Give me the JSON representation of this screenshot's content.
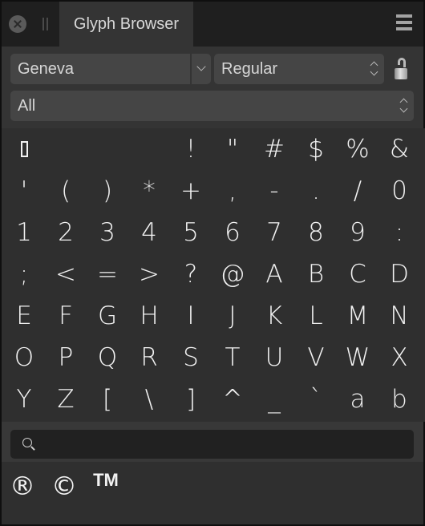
{
  "window": {
    "tab_title": "Glyph Browser",
    "close_icon": "close-circle-icon",
    "grip_icon": "drag-grip-icon",
    "menu_icon": "hamburger-menu-icon"
  },
  "controls": {
    "font_family": "Geneva",
    "font_style": "Regular",
    "lock_icon": "unlocked-padlock-icon",
    "category": "All"
  },
  "glyphs": [
    "▯",
    " ",
    " ",
    " ",
    "!",
    "\"",
    "#",
    "$",
    "%",
    "&",
    "'",
    "(",
    ")",
    "*",
    "+",
    ",",
    "-",
    ".",
    "/",
    "0",
    "1",
    "2",
    "3",
    "4",
    "5",
    "6",
    "7",
    "8",
    "9",
    ":",
    ";",
    "<",
    "=",
    ">",
    "?",
    "@",
    "A",
    "B",
    "C",
    "D",
    "E",
    "F",
    "G",
    "H",
    "I",
    "J",
    "K",
    "L",
    "M",
    "N",
    "O",
    "P",
    "Q",
    "R",
    "S",
    "T",
    "U",
    "V",
    "W",
    "X",
    "Y",
    "Z",
    "[",
    "\\",
    "]",
    "^",
    "_",
    "`",
    "a",
    "b"
  ],
  "search": {
    "value": "",
    "placeholder": ""
  },
  "recent_glyphs": [
    "®",
    "©",
    "TM"
  ],
  "colors": {
    "panel_bg": "#2f2f2f",
    "titlebar_bg": "#1f1f1f",
    "control_bg": "#454545",
    "glyph_fg": "#f2f2f2"
  }
}
